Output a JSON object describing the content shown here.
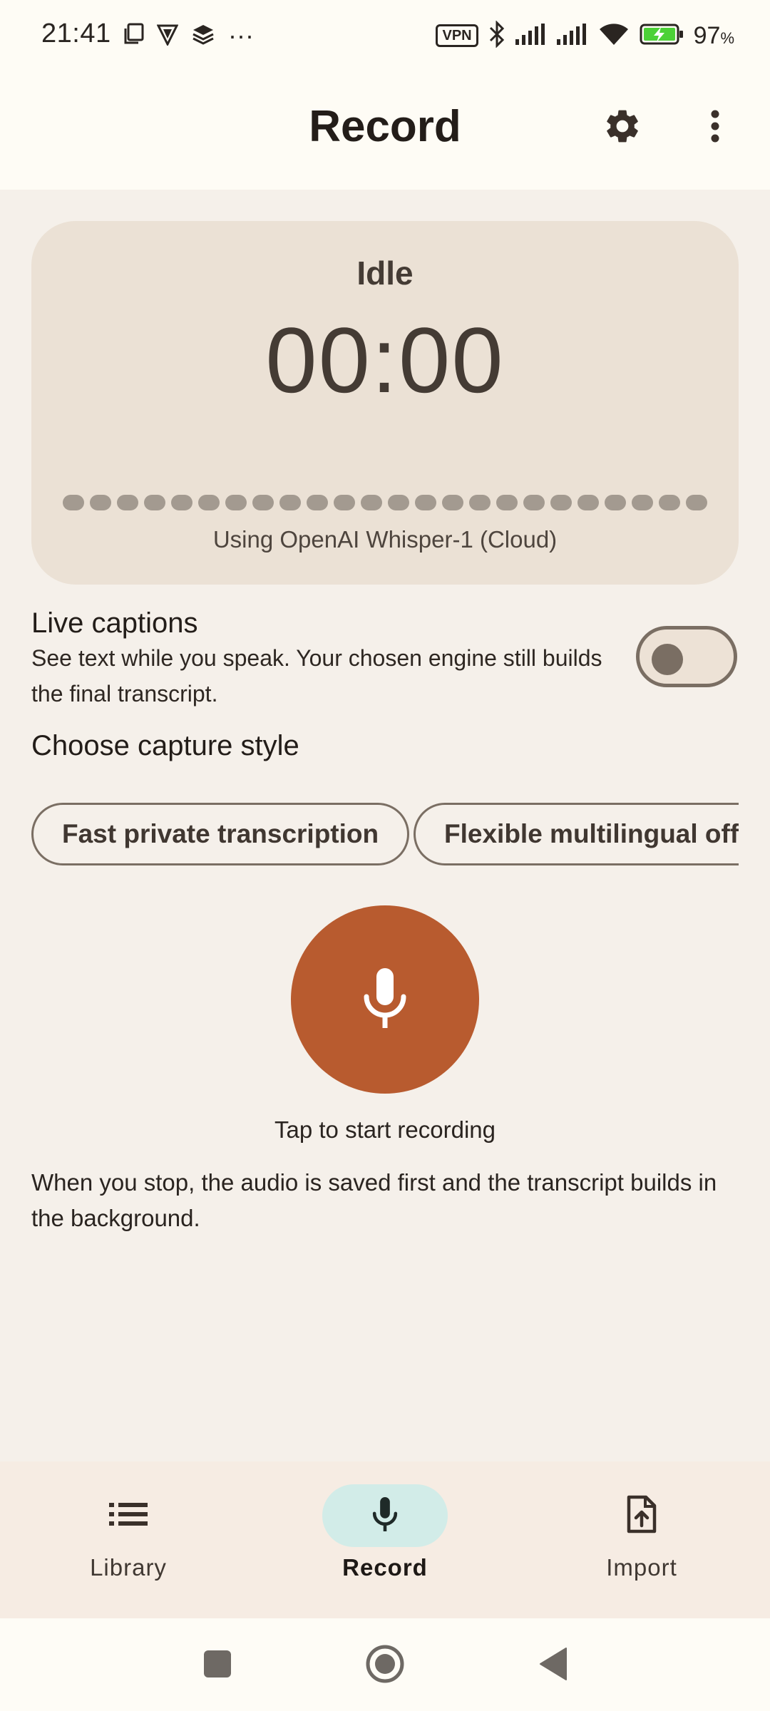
{
  "status_bar": {
    "time": "21:41",
    "left_icons": [
      "copy-icon",
      "vpn-shield-icon",
      "stack-icon",
      "more-notifications-icon"
    ],
    "overflow": "···",
    "vpn": "VPN",
    "battery_percent": "97",
    "battery_unit": "%"
  },
  "app_bar": {
    "title": "Record",
    "settings_icon": "gear-icon",
    "overflow_icon": "more-vert-icon"
  },
  "status_card": {
    "state": "Idle",
    "timer": "00:00",
    "engine": "Using OpenAI Whisper-1 (Cloud)"
  },
  "live_captions": {
    "title": "Live captions",
    "description": "See text while you speak. Your chosen engine still builds the final transcript.",
    "enabled": false
  },
  "capture_style": {
    "title": "Choose capture style",
    "options": [
      "Fast private transcription",
      "Flexible multilingual offli"
    ]
  },
  "record": {
    "icon": "mic-icon",
    "hint": "Tap to start recording",
    "info": "When you stop, the audio is saved first and the transcript builds in the background."
  },
  "bottom_nav": {
    "items": [
      {
        "label": "Library",
        "icon": "list-icon",
        "active": false
      },
      {
        "label": "Record",
        "icon": "mic-icon",
        "active": true
      },
      {
        "label": "Import",
        "icon": "file-upload-icon",
        "active": false
      }
    ]
  },
  "colors": {
    "accent_record": "#b85b2f",
    "card_bg": "#ebe1d5",
    "nav_active_pill": "#d2ece8",
    "battery_green": "#4cd137"
  }
}
